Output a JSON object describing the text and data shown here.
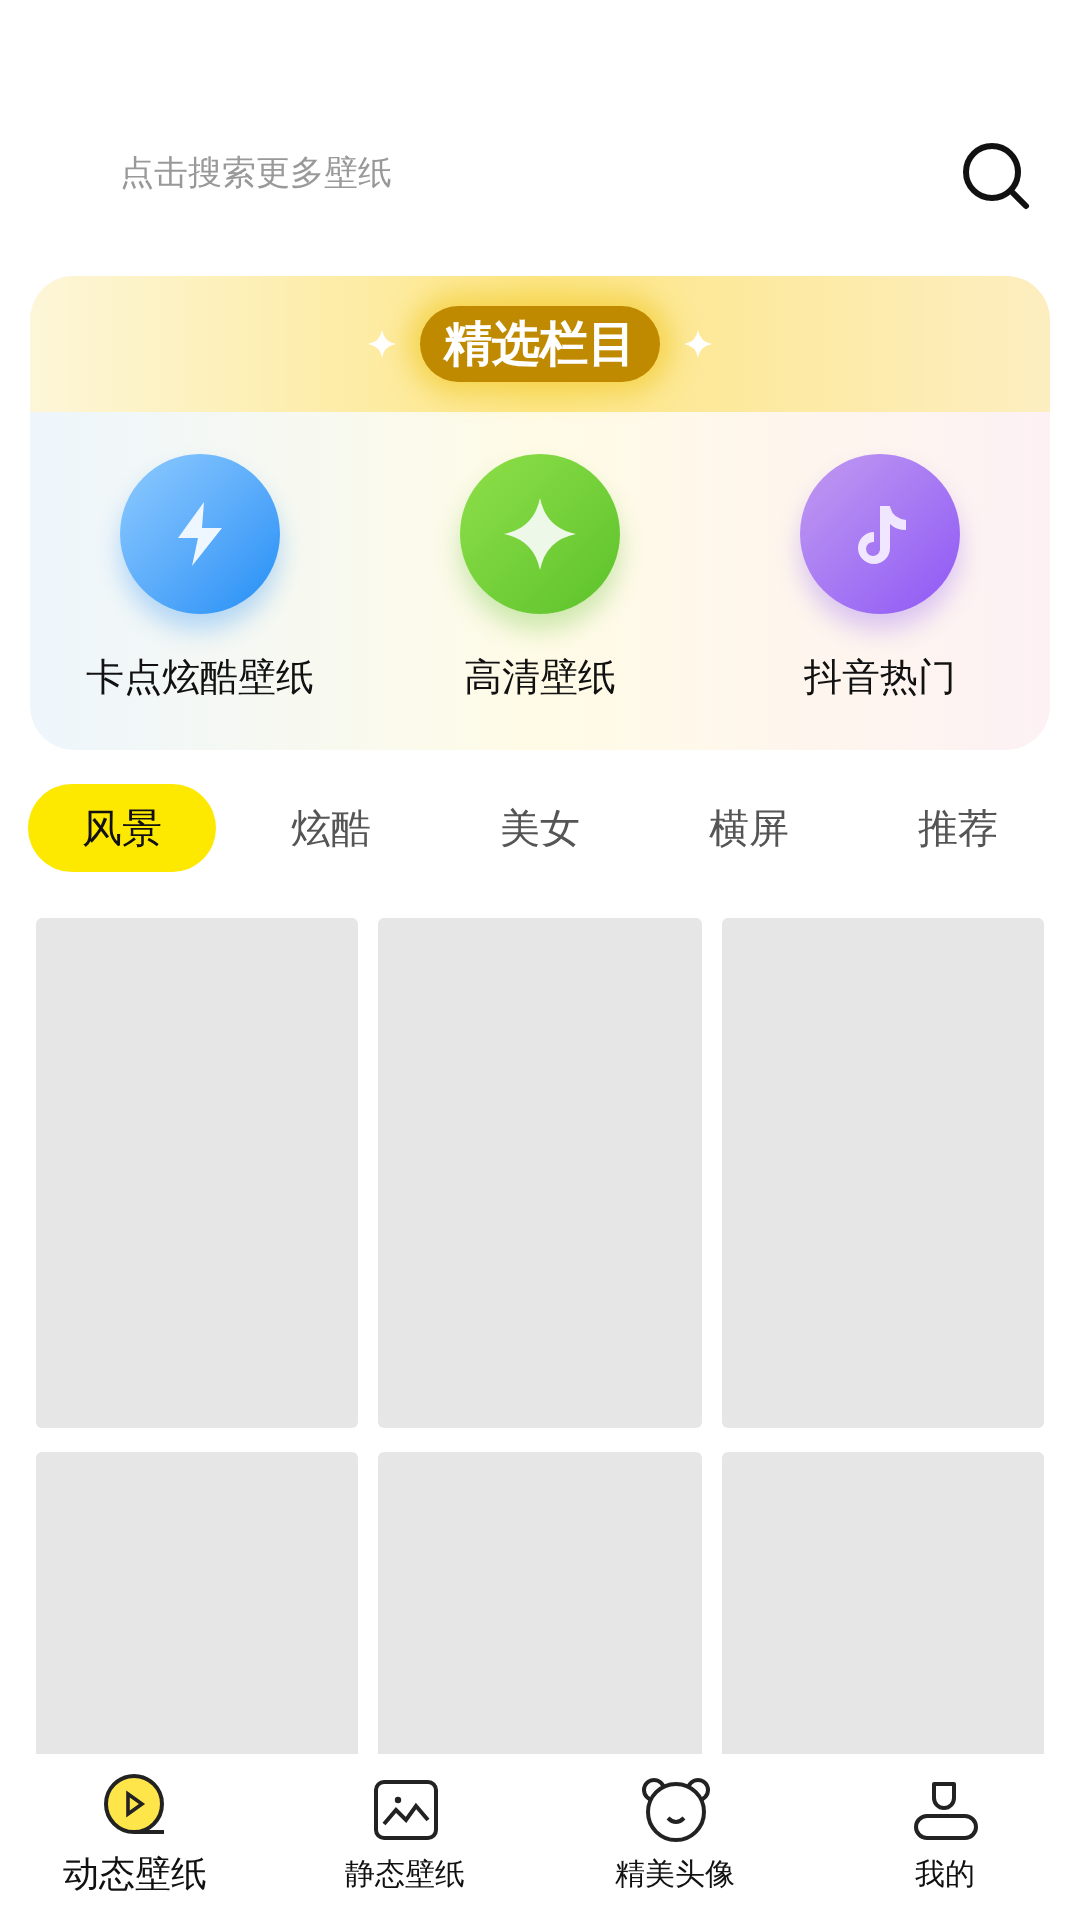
{
  "search": {
    "placeholder": "点击搜索更多壁纸"
  },
  "featured": {
    "title": "精选栏目",
    "items": [
      {
        "kind": "bolt",
        "label": "卡点炫酷壁纸"
      },
      {
        "kind": "sparkle",
        "label": "高清壁纸"
      },
      {
        "kind": "note",
        "label": "抖音热门"
      }
    ]
  },
  "tabs": [
    {
      "label": "风景",
      "selected": true
    },
    {
      "label": "炫酷",
      "selected": false
    },
    {
      "label": "美女",
      "selected": false
    },
    {
      "label": "横屏",
      "selected": false
    },
    {
      "label": "推荐",
      "selected": false
    }
  ],
  "grid": [
    {
      "kind": "placeholder"
    },
    {
      "kind": "placeholder"
    },
    {
      "kind": "placeholder"
    },
    {
      "kind": "placeholder"
    },
    {
      "kind": "placeholder"
    },
    {
      "kind": "placeholder"
    }
  ],
  "bottom_nav": [
    {
      "kind": "video",
      "label": "动态壁纸",
      "selected": true
    },
    {
      "kind": "image",
      "label": "静态壁纸",
      "selected": false
    },
    {
      "kind": "bear",
      "label": "精美头像",
      "selected": false
    },
    {
      "kind": "user",
      "label": "我的",
      "selected": false
    }
  ]
}
